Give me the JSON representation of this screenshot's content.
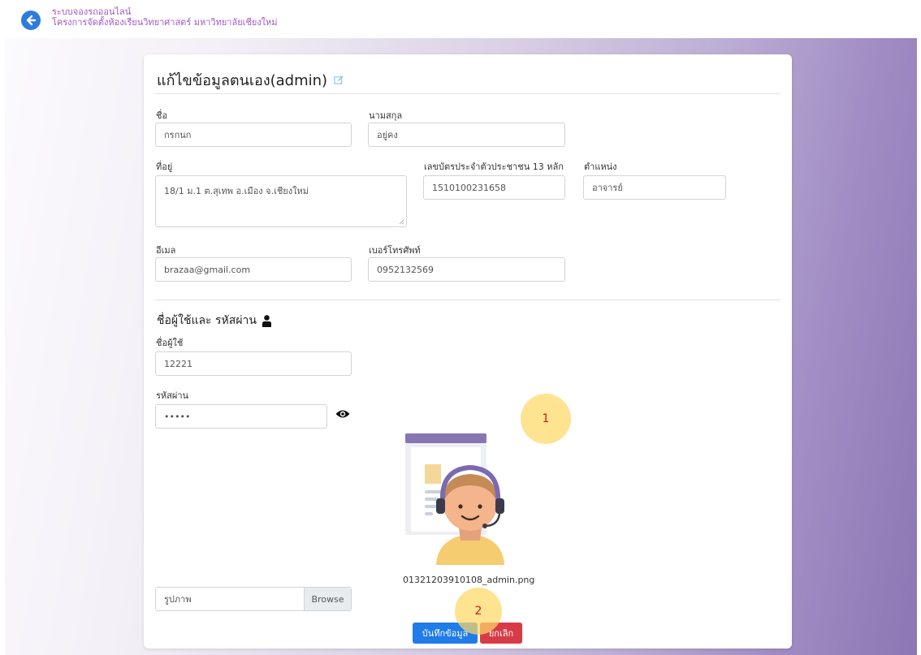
{
  "header": {
    "line1": "ระบบจองรถออนไลน์",
    "line2": "โครงการจัดตั้งห้องเรียนวิทยาศาสตร์ มหาวิทยาลัยเชียงใหม่"
  },
  "form": {
    "title": "แก้ไขข้อมูลตนเอง(admin)",
    "first_name": {
      "label": "ชื่อ",
      "value": "กรกนก"
    },
    "last_name": {
      "label": "นามสกุล",
      "value": "อยู่คง"
    },
    "address": {
      "label": "ที่อยู่",
      "value": "18/1 ม.1 ต.สุเทพ อ.เมือง จ.เชียงใหม่"
    },
    "id_card": {
      "label": "เลขบัตรประจำตัวประชาชน 13 หลัก",
      "value": "1510100231658"
    },
    "position": {
      "label": "ตำแหน่ง",
      "value": "อาจารย์"
    },
    "email": {
      "label": "อีเมล",
      "value": "brazaa@gmail.com"
    },
    "phone": {
      "label": "เบอร์โทรศัพท์",
      "value": "0952132569"
    }
  },
  "account": {
    "title": "ชื่อผู้ใช้และ รหัสผ่าน",
    "username": {
      "label": "ชื่อผู้ใช้",
      "value": "12221"
    },
    "password": {
      "label": "รหัสผ่าน",
      "value": "•••••"
    }
  },
  "image": {
    "placeholder": "รูปภาพ",
    "browse": "Browse",
    "filename": "01321203910108_admin.png"
  },
  "buttons": {
    "save": "บันทึกข้อมูล",
    "cancel": "ยกเลิก"
  },
  "markers": {
    "m1": "1",
    "m2": "2"
  },
  "colors": {
    "primary": "#1f7ce8",
    "danger": "#d83b46",
    "header_text": "#a257c9",
    "marker": "#fdd866"
  },
  "icons": [
    "back-arrow-icon",
    "edit-icon",
    "user-icon",
    "eye-icon"
  ]
}
